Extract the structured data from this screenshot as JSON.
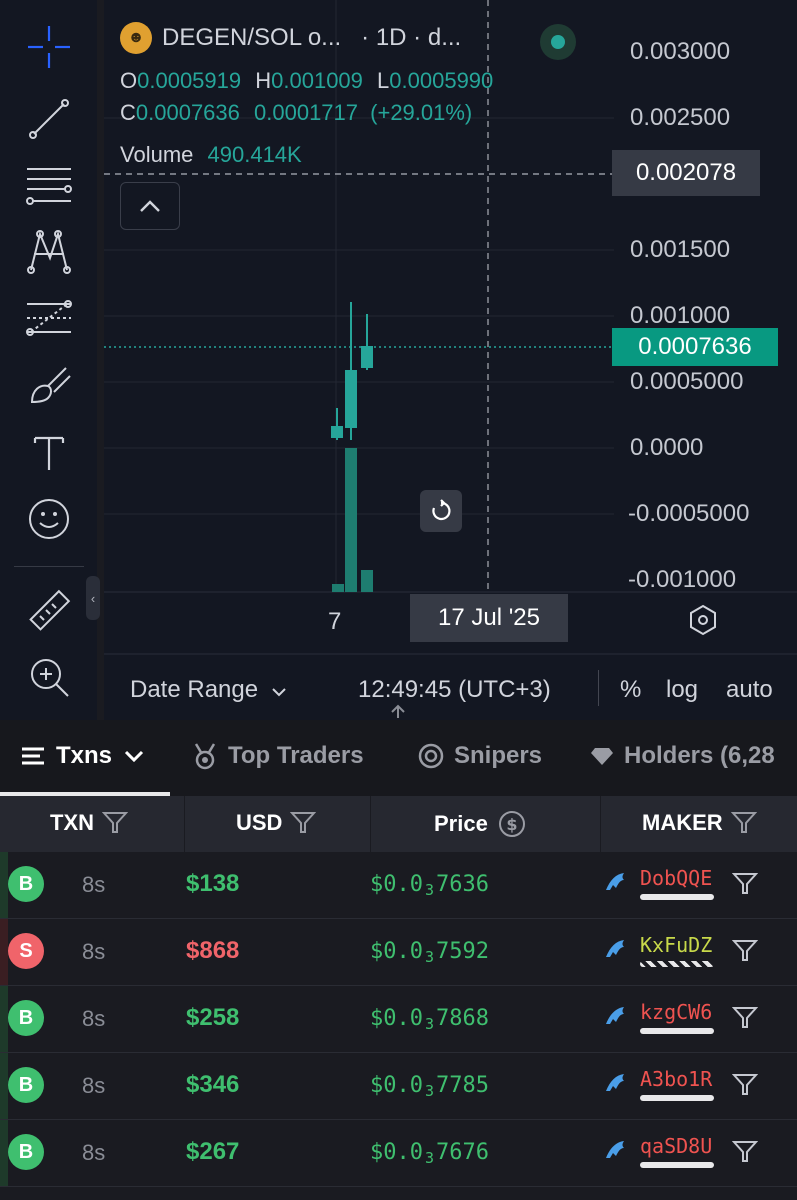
{
  "chart": {
    "symbol": "DEGEN/SOL o...",
    "interval": "· 1D · d...",
    "ohlc": {
      "o_label": "O",
      "o": "0.0005919",
      "h_label": "H",
      "h": "0.001009",
      "l_label": "L",
      "l": "0.0005990",
      "c_label": "C",
      "c": "0.0007636",
      "change": "0.0001717",
      "change_pct": "(+29.01%)"
    },
    "volume_label": "Volume",
    "volume": "490.414K",
    "price_axis": [
      "0.003000",
      "0.002500",
      "0.001500",
      "0.001000",
      "0.0005000",
      "0.0000",
      "-0.0005000",
      "-0.001000"
    ],
    "crosshair_price": "0.002078",
    "last_price": "0.0007636",
    "time_axis_label": "7",
    "crosshair_date": "17 Jul '25",
    "colors": {
      "up": "#26a69a",
      "last_price_bg": "#089981",
      "down": "#ef5350"
    }
  },
  "bottom_bar": {
    "date_range": "Date Range",
    "clock": "12:49:45 (UTC+3)",
    "percent": "%",
    "log": "log",
    "auto": "auto"
  },
  "tabs": [
    {
      "label": "Txns"
    },
    {
      "label": "Top Traders"
    },
    {
      "label": "Snipers"
    },
    {
      "label": "Holders (6,28"
    }
  ],
  "table": {
    "headers": {
      "txn": "TXN",
      "usd": "USD",
      "price": "Price",
      "maker": "MAKER"
    },
    "rows": [
      {
        "type": "B",
        "age": "8s",
        "usd": "$138",
        "price_prefix": "$0.0",
        "price_zeros": "3",
        "price_digits": "7636",
        "maker": "DobQQE",
        "maker_color": "#ef5350"
      },
      {
        "type": "S",
        "age": "8s",
        "usd": "$868",
        "price_prefix": "$0.0",
        "price_zeros": "3",
        "price_digits": "7592",
        "maker": "KxFuDZ",
        "maker_color": "#c8d94a"
      },
      {
        "type": "B",
        "age": "8s",
        "usd": "$258",
        "price_prefix": "$0.0",
        "price_zeros": "3",
        "price_digits": "7868",
        "maker": "kzgCW6",
        "maker_color": "#ef5350"
      },
      {
        "type": "B",
        "age": "8s",
        "usd": "$346",
        "price_prefix": "$0.0",
        "price_zeros": "3",
        "price_digits": "7785",
        "maker": "A3bo1R",
        "maker_color": "#ef5350"
      },
      {
        "type": "B",
        "age": "8s",
        "usd": "$267",
        "price_prefix": "$0.0",
        "price_zeros": "3",
        "price_digits": "7676",
        "maker": "qaSD8U",
        "maker_color": "#ef5350"
      }
    ],
    "colors": {
      "buy": "#3fbf6f",
      "sell": "#f0646a"
    }
  }
}
